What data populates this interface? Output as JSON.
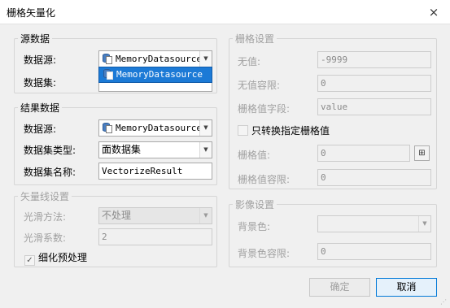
{
  "window": {
    "title": "栅格矢量化",
    "close_icon": "×"
  },
  "source": {
    "title": "源数据",
    "datasource_label": "数据源:",
    "datasource_value": "MemoryDatasource",
    "dataset_label": "数据集:",
    "dropdown_item": "MemoryDatasource"
  },
  "result": {
    "title": "结果数据",
    "datasource_label": "数据源:",
    "datasource_value": "MemoryDatasource",
    "dataset_type_label": "数据集类型:",
    "dataset_type_value": "面数据集",
    "dataset_name_label": "数据集名称:",
    "dataset_name_value": "VectorizeResult"
  },
  "vector_line": {
    "title": "矢量线设置",
    "smooth_method_label": "光滑方法:",
    "smooth_method_value": "不处理",
    "smooth_coef_label": "光滑系数:",
    "smooth_coef_value": "2",
    "thin_label": "细化预处理",
    "thin_check": "✓"
  },
  "raster": {
    "title": "栅格设置",
    "nodata_label": "无值:",
    "nodata_value": "-9999",
    "nodata_tol_label": "无值容限:",
    "nodata_tol_value": "0",
    "value_field_label": "栅格值字段:",
    "value_field_value": "value",
    "only_specified_label": "只转换指定栅格值",
    "grid_value_label": "栅格值:",
    "grid_value_value": "0",
    "grid_tol_label": "栅格值容限:",
    "grid_tol_value": "0"
  },
  "image": {
    "title": "影像设置",
    "bg_color_label": "背景色:",
    "bg_tol_label": "背景色容限:",
    "bg_tol_value": "0"
  },
  "buttons": {
    "ok": "确定",
    "cancel": "取消"
  },
  "icons": {
    "combo_arrow": "▼",
    "picker": "⊞",
    "grip": "⋰"
  }
}
